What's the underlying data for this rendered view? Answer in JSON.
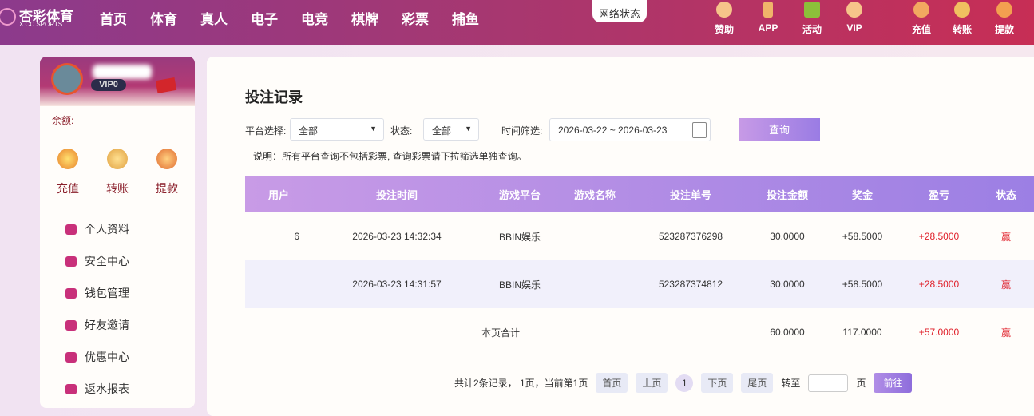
{
  "header": {
    "logo_title": "杏彩体育",
    "logo_sub": "X.CC SPORTS",
    "nav": [
      "首页",
      "体育",
      "真人",
      "电子",
      "电竞",
      "棋牌",
      "彩票",
      "捕鱼"
    ],
    "network_status": "网络状态",
    "right_icons": [
      {
        "label": "赞助",
        "icon": "heart-handshake-icon"
      },
      {
        "label": "APP",
        "icon": "phone-icon"
      },
      {
        "label": "活动",
        "icon": "gift-icon"
      },
      {
        "label": "VIP",
        "icon": "diamond-icon"
      },
      {
        "label": "充值",
        "icon": "money-bag-icon"
      },
      {
        "label": "转账",
        "icon": "gold-fish-icon"
      },
      {
        "label": "提款",
        "icon": "fan-icon"
      }
    ]
  },
  "sidebar": {
    "vip": "VIP0",
    "balance_label": "余额:",
    "quick_actions": [
      "充值",
      "转账",
      "提款"
    ],
    "menu": [
      "个人资料",
      "安全中心",
      "钱包管理",
      "好友邀请",
      "优惠中心",
      "返水报表"
    ]
  },
  "main": {
    "title": "投注记录",
    "platform_label": "平台选择:",
    "platform_value": "全部",
    "status_label": "状态:",
    "status_value": "全部",
    "time_label": "时间筛选:",
    "date_range": "2026-03-22 ~ 2026-03-23",
    "query": "查询",
    "note": "说明：所有平台查询不包括彩票, 查询彩票请下拉筛选单独查询。",
    "columns": [
      "用户",
      "投注时间",
      "游戏平台",
      "游戏名称",
      "投注单号",
      "投注金额",
      "奖金",
      "盈亏",
      "状态"
    ],
    "rows": [
      {
        "user": "6",
        "time": "2026-03-23 14:32:34",
        "platform": "BBIN娱乐",
        "game": "",
        "order": "523287376298",
        "amount": "30.0000",
        "bonus": "+58.5000",
        "profit": "+28.5000",
        "status": "赢"
      },
      {
        "user": "",
        "time": "2026-03-23 14:31:57",
        "platform": "BBIN娱乐",
        "game": "",
        "order": "523287374812",
        "amount": "30.0000",
        "bonus": "+58.5000",
        "profit": "+28.5000",
        "status": "赢"
      }
    ],
    "total": {
      "label": "本页合计",
      "amount": "60.0000",
      "bonus": "117.0000",
      "profit": "+57.0000",
      "status": "赢"
    },
    "pagination": {
      "summary": "共计2条记录， 1页，当前第1页",
      "first": "首页",
      "prev": "上页",
      "current": "1",
      "next": "下页",
      "last": "尾页",
      "goto_label": "转至",
      "page_unit": "页",
      "go": "前往"
    }
  }
}
